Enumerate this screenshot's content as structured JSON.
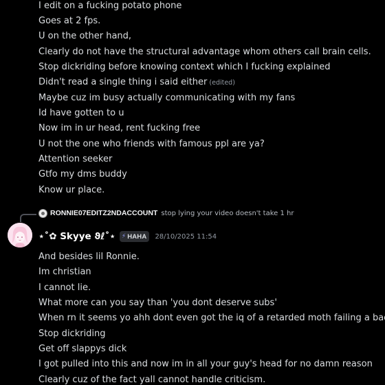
{
  "previous_message": {
    "lines": [
      "I edit on a fucking potato phone",
      "Goes at 2 fps.",
      "U on the other hand,",
      "Clearly do not have the structural advantage whom others call brain cells.",
      "Stop dickriding before knowing context which I fucking explained",
      "Didn't read a single thing i said either",
      "Maybe cuz im busy actually communicating with my fans",
      "Id have gotten to u",
      "Now im in ur head, rent fucking free",
      "U not the one who friends with famous ppl are ya?",
      "Attention seeker",
      "Gtfo my dms buddy",
      "Know ur place."
    ],
    "edited_label": "(edited)"
  },
  "reply": {
    "author": "RONNIE07EDITZ2NDACCOUNT",
    "text": "stop lying your video doesn't take 1 hr"
  },
  "message": {
    "author": "⋆˚✿ Skyye ϑℓ˚⋆",
    "tag": "HAHA",
    "tag_icon": "lightning-icon",
    "timestamp": "28/10/2025 11:54",
    "lines": [
      "And besides lil Ronnie.",
      "Im christian",
      "I cannot lie.",
      "What more can you say than 'you dont deserve subs'",
      "When rn it seems yo ahh dont even got the iq of a retarded moth failing a backflip.",
      "Stop dickriding",
      "Get off slappys dick",
      "I got pulled into this and now im in all your guy's head for no damn reason",
      "Clearly cuz of the fact yall cannot handle criticism."
    ]
  },
  "colors": {
    "background": "#000000",
    "text": "#dbdee1",
    "muted": "#949ba4",
    "accent": "#949cf7"
  }
}
